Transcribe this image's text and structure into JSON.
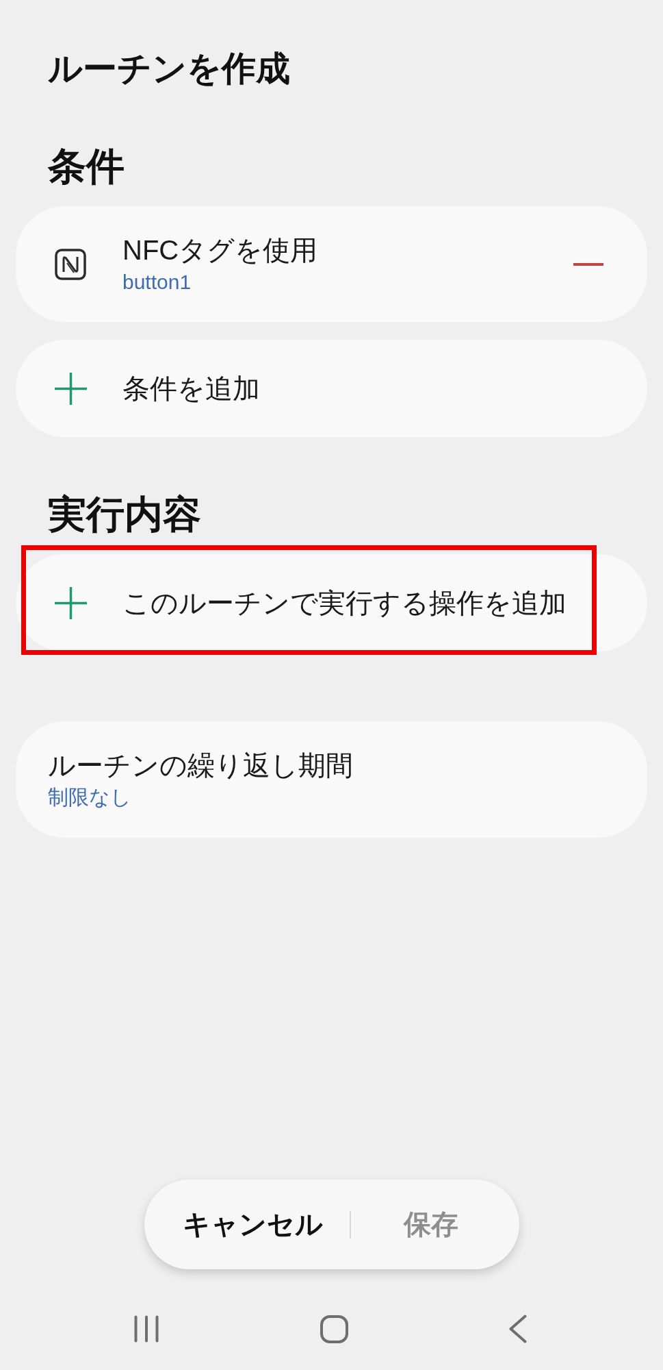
{
  "title": "ルーチンを作成",
  "sections": [
    {
      "heading": "条件",
      "items": [
        {
          "kind": "condition",
          "label": "NFCタグを使用",
          "value": "button1",
          "highlighted": false
        },
        {
          "kind": "add",
          "label": "条件を追加",
          "highlighted": false
        }
      ]
    },
    {
      "heading": "実行内容",
      "items": [
        {
          "kind": "add",
          "label": "このルーチンで実行する操作を追加",
          "highlighted": true
        }
      ]
    }
  ],
  "repeat": {
    "label": "ルーチンの繰り返し期間",
    "value": "制限なし"
  },
  "actions": [
    {
      "label": "キャンセル",
      "disabled": false
    },
    {
      "label": "保存",
      "disabled": true
    }
  ]
}
